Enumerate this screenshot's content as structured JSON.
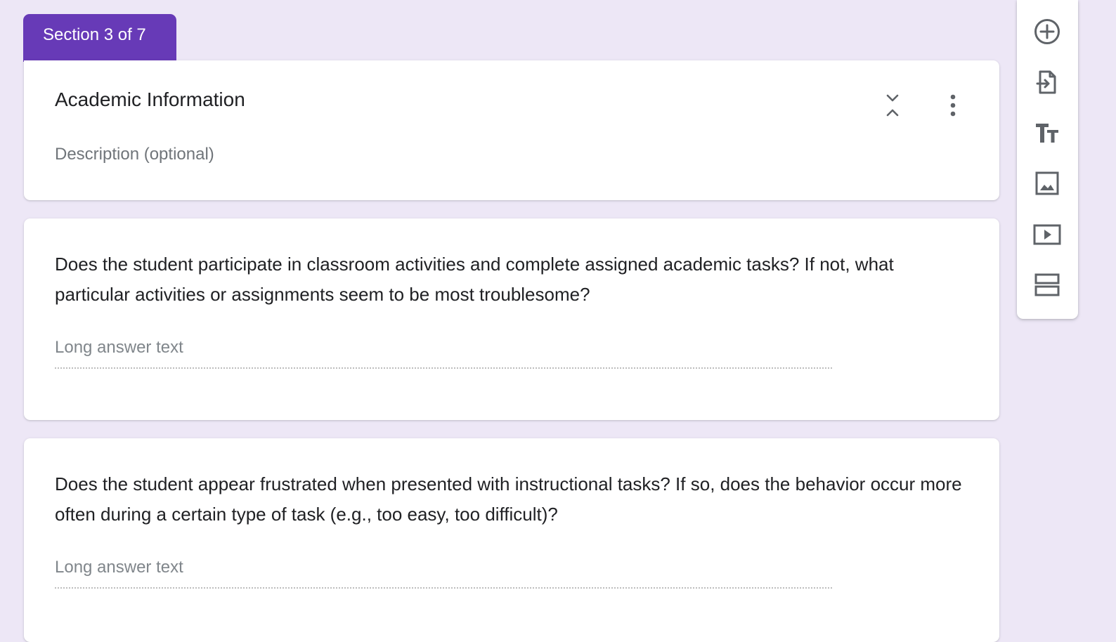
{
  "section_tab": {
    "label": "Section 3 of 7"
  },
  "section": {
    "title": "Academic Information",
    "description_placeholder": "Description (optional)"
  },
  "questions": [
    {
      "text": "Does the student participate in classroom activities and complete assigned academic tasks? If not, what particular activities or assignments seem to be most troublesome?",
      "answer_placeholder": "Long answer text"
    },
    {
      "text": "Does the student appear frustrated when presented with instructional tasks? If so, does the behavior occur more often during a certain type of task (e.g., too easy, too difficult)?",
      "answer_placeholder": "Long answer text"
    }
  ],
  "toolbar": {
    "items": [
      {
        "icon": "add-circle-icon"
      },
      {
        "icon": "import-questions-icon"
      },
      {
        "icon": "title-text-icon"
      },
      {
        "icon": "image-icon"
      },
      {
        "icon": "video-icon"
      },
      {
        "icon": "section-icon"
      }
    ]
  },
  "colors": {
    "background": "#ede7f6",
    "accent": "#673ab7",
    "card": "#ffffff",
    "icon": "#5f6368"
  }
}
